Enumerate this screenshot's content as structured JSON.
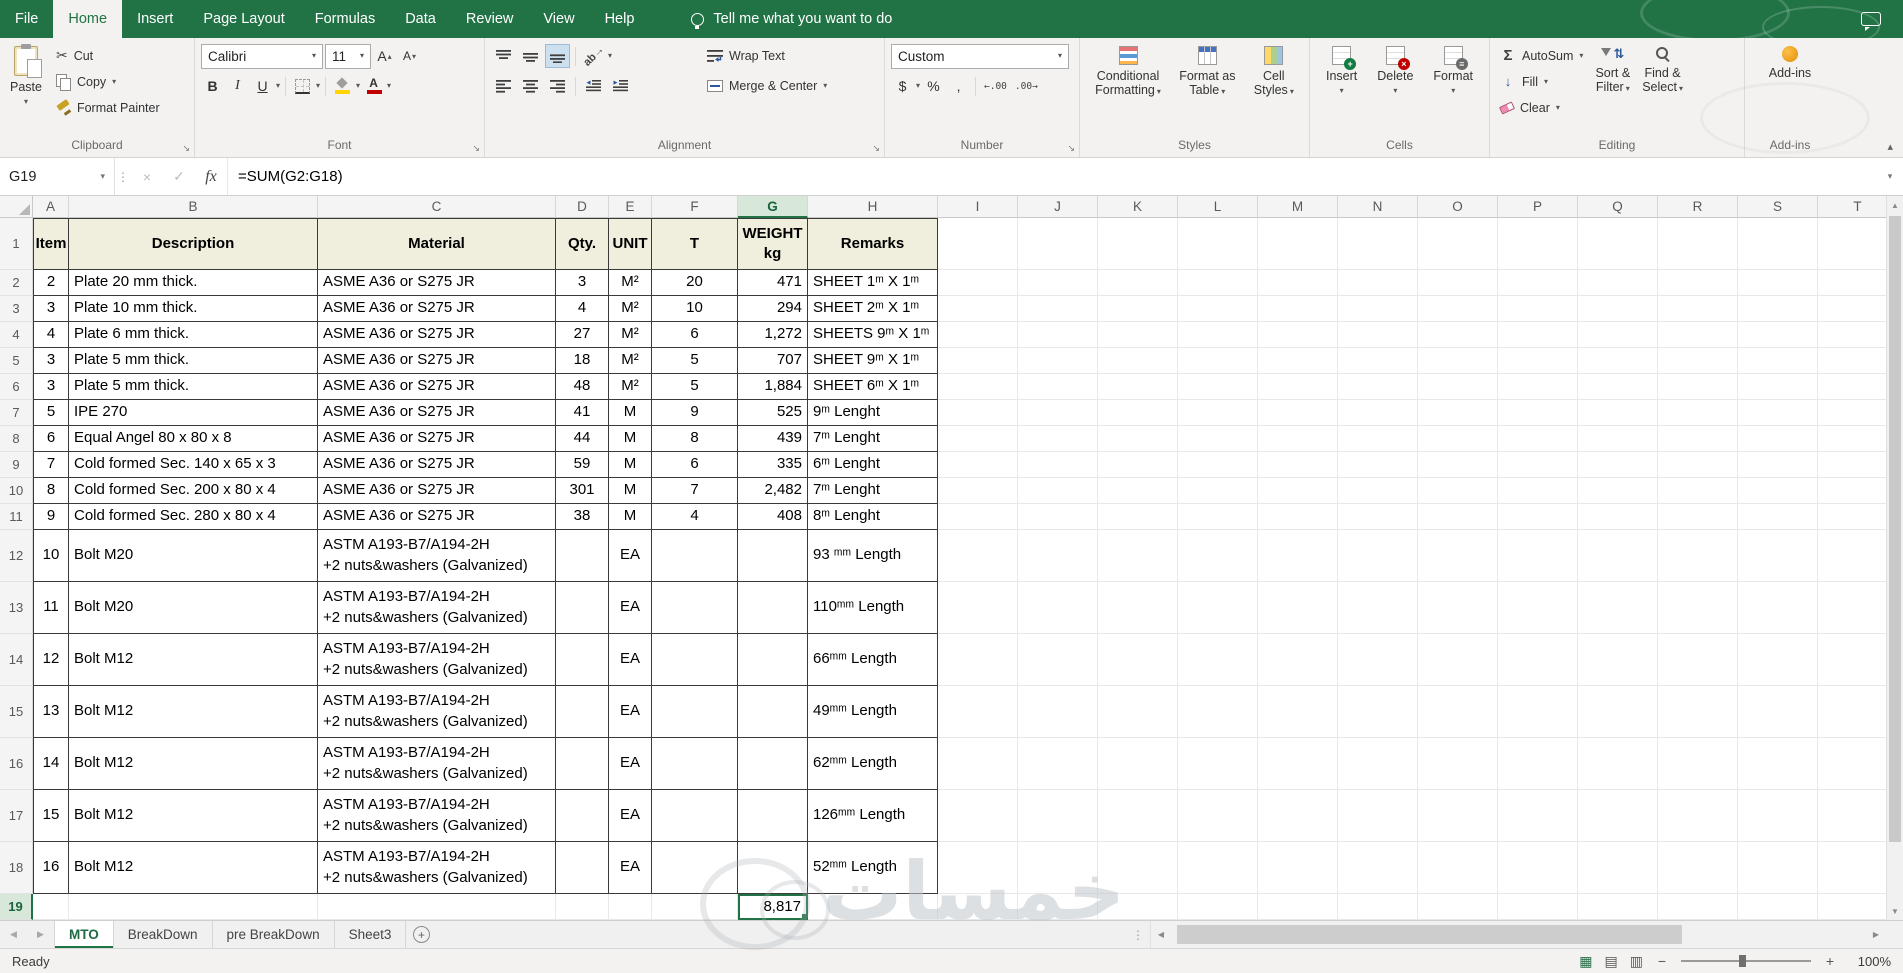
{
  "colors": {
    "excel_green": "#217346",
    "table_header_fill": "#f0eedc",
    "selection": "#217346"
  },
  "titlebar": {
    "tabs": [
      "File",
      "Home",
      "Insert",
      "Page Layout",
      "Formulas",
      "Data",
      "Review",
      "View",
      "Help"
    ],
    "active_tab": "Home",
    "tell_me": "Tell me what you want to do"
  },
  "ribbon": {
    "clipboard": {
      "label": "Clipboard",
      "paste": "Paste",
      "cut": "Cut",
      "copy": "Copy",
      "format_painter": "Format Painter"
    },
    "font": {
      "label": "Font",
      "font_name": "Calibri",
      "font_size": "11",
      "bold": "B",
      "italic": "I",
      "underline": "U"
    },
    "alignment": {
      "label": "Alignment",
      "wrap_text": "Wrap Text",
      "merge_center": "Merge & Center"
    },
    "number": {
      "label": "Number",
      "format": "Custom",
      "currency": "$",
      "percent": "%",
      "comma": ","
    },
    "styles": {
      "label": "Styles",
      "conditional_formatting": "Conditional\nFormatting",
      "format_as_table": "Format as\nTable",
      "cell_styles": "Cell\nStyles"
    },
    "cells": {
      "label": "Cells",
      "insert": "Insert",
      "delete": "Delete",
      "format": "Format"
    },
    "editing": {
      "label": "Editing",
      "autosum": "AutoSum",
      "fill": "Fill",
      "clear": "Clear",
      "sort_filter": "Sort &\nFilter",
      "find_select": "Find &\nSelect"
    },
    "addins": {
      "label": "Add-ins",
      "button": "Add-ins"
    }
  },
  "formula_bar": {
    "name_box": "G19",
    "fx": "fx",
    "formula": "=SUM(G2:G18)"
  },
  "grid": {
    "columns": [
      "A",
      "B",
      "C",
      "D",
      "E",
      "F",
      "G",
      "H",
      "I",
      "J",
      "K",
      "L",
      "M",
      "N",
      "O",
      "P",
      "Q",
      "R",
      "S",
      "T"
    ],
    "row_numbers": [
      "1",
      "2",
      "3",
      "4",
      "5",
      "6",
      "7",
      "8",
      "9",
      "10",
      "11",
      "12",
      "13",
      "14",
      "15",
      "16",
      "17",
      "18",
      "19"
    ],
    "selected_column": "G",
    "selected_row": "19",
    "selected_cell": "G19"
  },
  "table": {
    "headers": [
      "Item",
      "Description",
      "Material",
      "Qty.",
      "UNIT",
      "T",
      "WEIGHT\nkg",
      "Remarks"
    ],
    "rows": [
      [
        "2",
        "Plate 20 mm thick.",
        "ASME A36 or S275 JR",
        "3",
        "M²",
        "20",
        "471",
        "SHEET 1ᵐ X 1ᵐ"
      ],
      [
        "3",
        "Plate 10 mm thick.",
        "ASME A36 or S275 JR",
        "4",
        "M²",
        "10",
        "294",
        "SHEET 2ᵐ X 1ᵐ"
      ],
      [
        "4",
        "Plate 6 mm thick.",
        "ASME A36 or S275 JR",
        "27",
        "M²",
        "6",
        "1,272",
        "SHEETS 9ᵐ X 1ᵐ"
      ],
      [
        "3",
        "Plate 5 mm thick.",
        "ASME A36 or S275 JR",
        "18",
        "M²",
        "5",
        "707",
        "SHEET 9ᵐ X 1ᵐ"
      ],
      [
        "3",
        "Plate 5 mm thick.",
        "ASME A36 or S275 JR",
        "48",
        "M²",
        "5",
        "1,884",
        "SHEET 6ᵐ X 1ᵐ"
      ],
      [
        "5",
        "IPE 270",
        "ASME A36 or S275 JR",
        "41",
        "M",
        "9",
        "525",
        "9ᵐ Lenght"
      ],
      [
        "6",
        "Equal Angel 80 x 80 x 8",
        "ASME A36 or S275 JR",
        "44",
        "M",
        "8",
        "439",
        "7ᵐ Lenght"
      ],
      [
        "7",
        "Cold formed Sec. 140 x 65 x 3",
        "ASME A36 or S275 JR",
        "59",
        "M",
        "6",
        "335",
        "6ᵐ Lenght"
      ],
      [
        "8",
        "Cold formed Sec. 200 x 80 x 4",
        "ASME A36 or S275 JR",
        "301",
        "M",
        "7",
        "2,482",
        "7ᵐ Lenght"
      ],
      [
        "9",
        "Cold formed Sec. 280 x 80 x 4",
        "ASME A36 or S275 JR",
        "38",
        "M",
        "4",
        "408",
        "8ᵐ Lenght"
      ],
      [
        "10",
        "Bolt M20",
        "ASTM A193-B7/A194-2H\n+2 nuts&washers (Galvanized)",
        "",
        "EA",
        "",
        "",
        "93 ᵐᵐ Length"
      ],
      [
        "11",
        "Bolt M20",
        "ASTM A193-B7/A194-2H\n+2 nuts&washers (Galvanized)",
        "",
        "EA",
        "",
        "",
        "110ᵐᵐ Length"
      ],
      [
        "12",
        "Bolt M12",
        "ASTM A193-B7/A194-2H\n+2 nuts&washers (Galvanized)",
        "",
        "EA",
        "",
        "",
        "66ᵐᵐ Length"
      ],
      [
        "13",
        "Bolt M12",
        "ASTM A193-B7/A194-2H\n+2 nuts&washers (Galvanized)",
        "",
        "EA",
        "",
        "",
        "49ᵐᵐ Length"
      ],
      [
        "14",
        "Bolt M12",
        "ASTM A193-B7/A194-2H\n+2 nuts&washers (Galvanized)",
        "",
        "EA",
        "",
        "",
        "62ᵐᵐ Length"
      ],
      [
        "15",
        "Bolt M12",
        "ASTM A193-B7/A194-2H\n+2 nuts&washers (Galvanized)",
        "",
        "EA",
        "",
        "",
        "126ᵐᵐ Length"
      ],
      [
        "16",
        "Bolt M12",
        "ASTM A193-B7/A194-2H\n+2 nuts&washers (Galvanized)",
        "",
        "EA",
        "",
        "",
        "52ᵐᵐ Length"
      ]
    ],
    "total": "8,817"
  },
  "sheet_tabs": {
    "tabs": [
      "MTO",
      "BreakDown",
      "pre BreakDown",
      "Sheet3"
    ],
    "active": "MTO"
  },
  "status_bar": {
    "status": "Ready",
    "zoom": "100%"
  },
  "watermark": "خمسات"
}
